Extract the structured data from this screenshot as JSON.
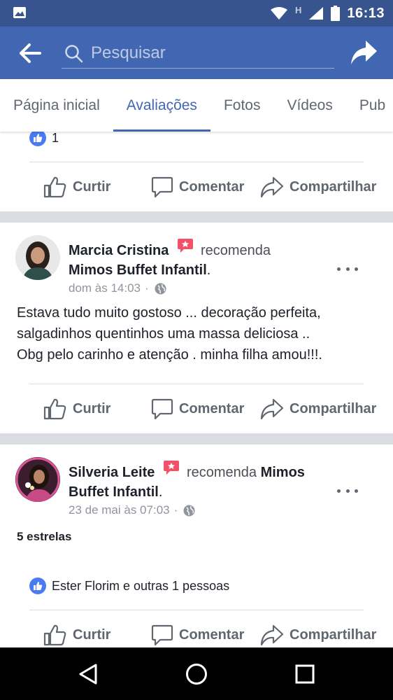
{
  "status_bar": {
    "time": "16:13",
    "network_label": "H"
  },
  "toolbar": {
    "search_placeholder": "Pesquisar"
  },
  "tabs": [
    {
      "label": "Página inicial"
    },
    {
      "label": "Avaliações"
    },
    {
      "label": "Fotos"
    },
    {
      "label": "Vídeos"
    },
    {
      "label": "Pub"
    }
  ],
  "prev_post": {
    "reaction_count": "1"
  },
  "actions": {
    "like": "Curtir",
    "comment": "Comentar",
    "share": "Compartilhar"
  },
  "posts": [
    {
      "author": "Marcia Cristina",
      "verb": "recomenda",
      "page": "Mimos Buffet Infantil",
      "time": "dom às 14:03",
      "text_lines": [
        "Estava tudo muito gostoso ... decoração  perfeita,",
        "salgadinhos quentinhos uma massa deliciosa ..",
        "Obg pelo carinho e atenção . minha filha amou!!!."
      ]
    },
    {
      "author": "Silveria Leite",
      "verb": "recomenda",
      "page_line1": "Mimos",
      "page_line2": "Buffet Infantil",
      "time": "23 de mai às 07:03",
      "rating": "5 estrelas",
      "reactions_text": "Ester Florim e outras 1 pessoas"
    }
  ],
  "icons": {
    "accent": "#4267b2",
    "status_bar_bg": "#38548f",
    "recommend_badge": "#f25268"
  }
}
